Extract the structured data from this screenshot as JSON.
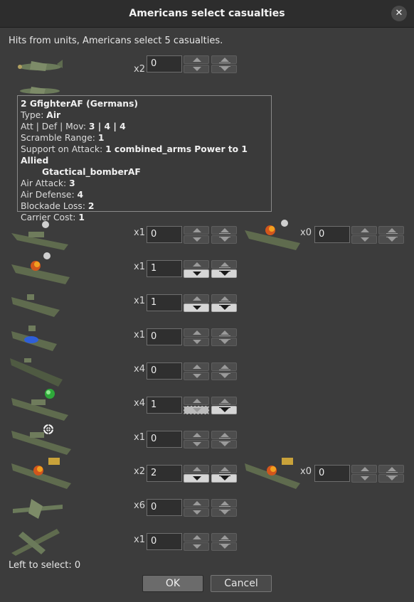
{
  "window": {
    "title": "Americans select casualties",
    "close_icon": "close-icon"
  },
  "message": "Hits from units,  Americans select 5 casualties.",
  "units": [
    {
      "icon": "fighter-plane-icon",
      "multiplier": "x2",
      "value": "0"
    },
    {
      "icon": "fighter-plane-icon",
      "multiplier": "",
      "value": ""
    },
    {
      "icon": "cruiser-icon",
      "multiplier": "x1",
      "value": "0",
      "damaged_icon": "damaged-carrier-icon",
      "multiplier2": "x0",
      "value2": "0"
    },
    {
      "icon": "damaged-carrier-icon",
      "multiplier": "x1",
      "value": "1"
    },
    {
      "icon": "submarine-icon",
      "multiplier": "x1",
      "value": "1"
    },
    {
      "icon": "transport-icon",
      "multiplier": "x1",
      "value": "0"
    },
    {
      "icon": "destroyer-icon",
      "multiplier": "x4",
      "value": "0"
    },
    {
      "icon": "battleship-icon",
      "multiplier": "x4",
      "value": "1"
    },
    {
      "icon": "battleship-target-icon",
      "multiplier": "x1",
      "value": "0"
    },
    {
      "icon": "damaged-battleship-icon",
      "multiplier": "x2",
      "value": "2",
      "damaged_icon": "damaged-battleship-icon",
      "multiplier2": "x0",
      "value2": "0"
    },
    {
      "icon": "tactical-bomber-icon",
      "multiplier": "x6",
      "value": "0"
    },
    {
      "icon": "heavy-bomber-icon",
      "multiplier": "x1",
      "value": "0"
    }
  ],
  "tooltip": {
    "title": "2 GfighterAF (Germans)",
    "type_label": "Type: ",
    "type_value": "Air",
    "stats_label": "Att | Def | Mov: ",
    "stats_value": "3 | 4 | 4",
    "scramble_label": "Scramble Range: ",
    "scramble_value": "1",
    "support_label": "Support on Attack: ",
    "support_value": "1 combined_arms Power to 1 Allied",
    "support_value2": "Gtactical_bomberAF",
    "air_attack_label": "Air Attack: ",
    "air_attack_value": "3",
    "air_defense_label": "Air Defense: ",
    "air_defense_value": "4",
    "blockade_label": "Blockade Loss: ",
    "blockade_value": "2",
    "carrier_label": "Carrier Cost: ",
    "carrier_value": "1"
  },
  "footer": {
    "left_to_select": "Left to select: 0"
  },
  "buttons": {
    "ok": "OK",
    "cancel": "Cancel"
  }
}
